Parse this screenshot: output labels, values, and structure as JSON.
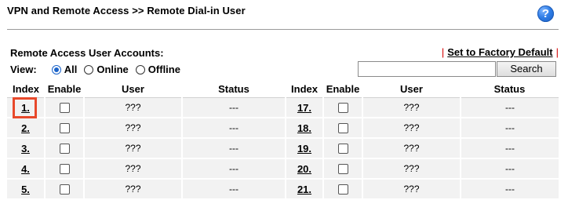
{
  "header": {
    "title": "VPN and Remote Access >> Remote Dial-in User",
    "help_label": "?"
  },
  "accounts": {
    "label": "Remote Access User Accounts:",
    "factory_sep": "|",
    "factory_label": "Set to Factory Default",
    "factory_sep_end": "|"
  },
  "view": {
    "label": "View:",
    "options": [
      "All",
      "Online",
      "Offline"
    ],
    "selected": "All"
  },
  "search": {
    "value": "",
    "button_label": "Search"
  },
  "table": {
    "headers": [
      "Index",
      "Enable",
      "User",
      "Status",
      "Index",
      "Enable",
      "User",
      "Status"
    ],
    "rows": [
      {
        "left": {
          "index": "1.",
          "user": "???",
          "status": "---"
        },
        "right": {
          "index": "17.",
          "user": "???",
          "status": "---"
        }
      },
      {
        "left": {
          "index": "2.",
          "user": "???",
          "status": "---"
        },
        "right": {
          "index": "18.",
          "user": "???",
          "status": "---"
        }
      },
      {
        "left": {
          "index": "3.",
          "user": "???",
          "status": "---"
        },
        "right": {
          "index": "19.",
          "user": "???",
          "status": "---"
        }
      },
      {
        "left": {
          "index": "4.",
          "user": "???",
          "status": "---"
        },
        "right": {
          "index": "20.",
          "user": "???",
          "status": "---"
        }
      },
      {
        "left": {
          "index": "5.",
          "user": "???",
          "status": "---"
        },
        "right": {
          "index": "21.",
          "user": "???",
          "status": "---"
        }
      }
    ]
  },
  "colors": {
    "highlight": "#e8492b",
    "factory_separator": "#d40000",
    "radio_selected": "#1a63c9",
    "help_icon": "#2f7de6"
  }
}
